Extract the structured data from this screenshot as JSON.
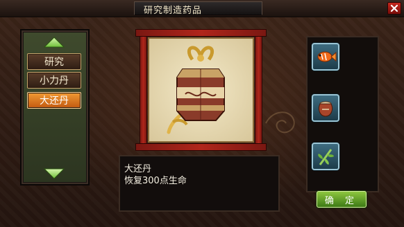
{
  "window": {
    "title": "研究制造药品",
    "close_icon": "close-icon"
  },
  "sidebar": {
    "scroll_up_icon": "arrow-up-icon",
    "scroll_down_icon": "arrow-down-icon",
    "items": [
      {
        "label": "研究",
        "selected": false
      },
      {
        "label": "小力丹",
        "selected": false
      },
      {
        "label": "大还丹",
        "selected": true
      }
    ]
  },
  "preview": {
    "item_icon": "medicine-pouch-icon"
  },
  "description": {
    "name": "大还丹",
    "effect": "恢复300点生命"
  },
  "ingredients": [
    {
      "icon": "fish-icon"
    },
    {
      "icon": "clay-pot-icon"
    },
    {
      "icon": "bamboo-herb-icon"
    }
  ],
  "actions": {
    "confirm_label": "确 定"
  },
  "colors": {
    "selected_tab": "#e07a20",
    "confirm_button": "#6aa82e",
    "frame_red": "#b0261b",
    "slot_blue": "#3e6c80"
  }
}
